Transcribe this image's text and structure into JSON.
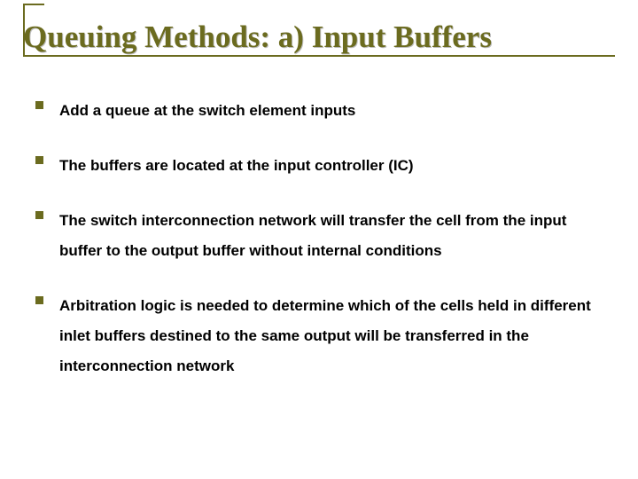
{
  "title": "Queuing Methods: a) Input Buffers",
  "bullets": [
    "Add a queue at the switch element inputs",
    "The buffers are located at the input controller (IC)",
    "The switch interconnection network will transfer the cell from the input buffer to the output buffer without internal conditions",
    "Arbitration logic is needed to determine which of the cells held in different inlet buffers destined to the same output will be transferred in the interconnection network"
  ]
}
